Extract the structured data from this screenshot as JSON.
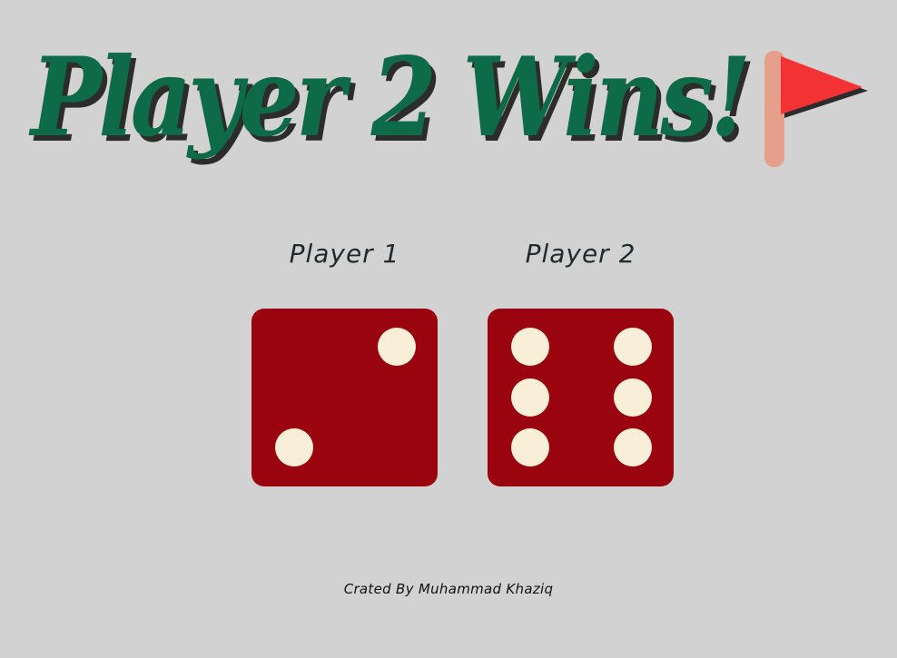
{
  "heading": {
    "text": "Player 2 Wins! ",
    "color": "#0e6b4a",
    "flag_icon": "red-flag-icon"
  },
  "players": [
    {
      "label": "Player 1",
      "die_value": 2
    },
    {
      "label": "Player 2",
      "die_value": 6
    }
  ],
  "colors": {
    "background": "#d2d2d2",
    "die": "#9a040e",
    "pip": "#f9efd8"
  },
  "footer": {
    "credit": "Crated By Muhammad Khaziq"
  }
}
